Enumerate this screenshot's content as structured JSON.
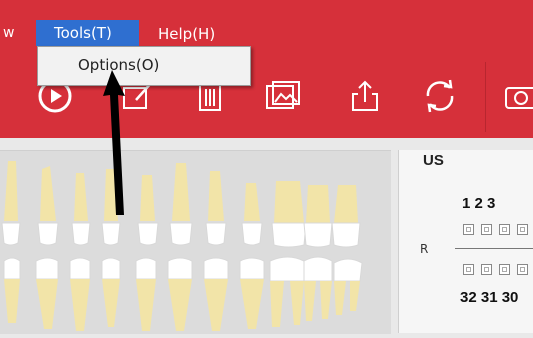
{
  "menu": {
    "partial_left": "w",
    "tools": "Tools(T)",
    "help": "Help(H)",
    "dropdown_item": "Options(O)"
  },
  "toolbar": {
    "icons": [
      "play-icon",
      "edit-icon",
      "delete-icon",
      "image-icon",
      "export-icon",
      "refresh-icon",
      "camera-icon"
    ]
  },
  "chart_panel": {
    "title": "US",
    "top_numbers": "1  2  3",
    "bottom_numbers": "32 31 30",
    "r_label": "R"
  },
  "colors": {
    "toolbar_red": "#d6303a",
    "menu_highlight": "#2f6fd0",
    "tooth_crown": "#ffffff",
    "tooth_root": "#f2e4a8"
  }
}
